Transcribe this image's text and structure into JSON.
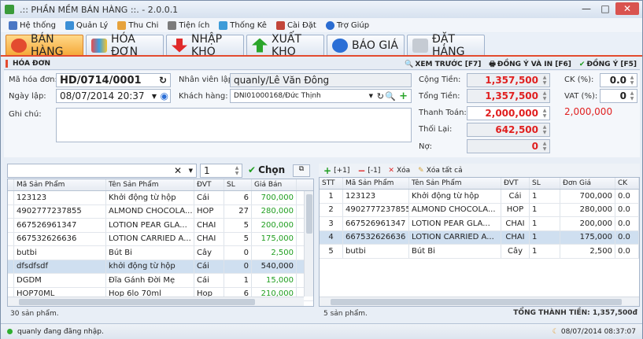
{
  "app": {
    "title": ".:: PHẦN MỀM BÁN HÀNG ::. - 2.0.0.1"
  },
  "menu": [
    {
      "label": "Hệ thống",
      "icon": "system-icon"
    },
    {
      "label": "Quản Lý",
      "icon": "manage-icon"
    },
    {
      "label": "Thu Chi",
      "icon": "money-icon"
    },
    {
      "label": "Tiện ích",
      "icon": "tools-icon"
    },
    {
      "label": "Thống Kê",
      "icon": "stats-icon"
    },
    {
      "label": "Cài Đặt",
      "icon": "settings-icon"
    },
    {
      "label": "Trợ Giúp",
      "icon": "help-icon"
    }
  ],
  "tabs": [
    {
      "label": "BÁN HÀNG",
      "color": "#e34b2f"
    },
    {
      "label": "HÓA ĐƠN",
      "color": "#d54fa0"
    },
    {
      "label": "NHẬP KHO",
      "color": "#e02a2a"
    },
    {
      "label": "XUẤT KHO",
      "color": "#2aa52a"
    },
    {
      "label": "BÁO GIÁ",
      "color": "#2b6fd6"
    },
    {
      "label": "ĐẶT HÀNG",
      "color": "#9aa4b0"
    }
  ],
  "invoice": {
    "header": "HÓA ĐƠN",
    "actions": {
      "preview": "XEM TRƯỚC [F7]",
      "approve_print": "ĐỒNG Ý VÀ IN [F6]",
      "approve": "ĐỒNG Ý [F5]"
    }
  },
  "form": {
    "invoice_no_label": "Mã hóa đơn:",
    "invoice_no": "HD/0714/0001",
    "date_label": "Ngày lập:",
    "date": "08/07/2014 20:37",
    "note_label": "Ghi chú:",
    "staff_label": "Nhân viên lập:",
    "staff": "quanly/Lê Văn Đông",
    "customer_label": "Khách hàng:",
    "customer": "DNI01000168/Đức Thịnh",
    "total_label": "Cộng Tiền:",
    "total": "1,357,500",
    "grand_total_label": "Tổng Tiền:",
    "grand_total": "1,357,500",
    "paid_label": "Thanh Toán:",
    "paid": "2,000,000",
    "change_label": "Thối Lại:",
    "change": "642,500",
    "debt_label": "Nợ:",
    "debt": "0",
    "discount_label": "CK (%):",
    "discount": "0.0",
    "vat_label": "VAT (%):",
    "vat": "0",
    "paid_display": "2,000,000"
  },
  "search": {
    "qty": "1",
    "choose": "Chọn"
  },
  "products": {
    "columns": [
      "Mã Sản Phẩm",
      "Tên Sản Phẩm",
      "ĐVT",
      "SL",
      "Giá Bán"
    ],
    "rows": [
      [
        "123123",
        "Khởi động từ hộp",
        "Cái",
        "6",
        "700,000"
      ],
      [
        "4902777237855",
        "ALMOND CHOCOLA...",
        "HOP",
        "27",
        "280,000"
      ],
      [
        "667526961347",
        "LOTION PEAR GLA...",
        "CHAI",
        "5",
        "200,000"
      ],
      [
        "667532626636",
        "LOTION CARRIED A...",
        "CHAI",
        "5",
        "175,000"
      ],
      [
        "butbi",
        "Bút Bi",
        "Cây",
        "0",
        "2,500"
      ],
      [
        "dfsdfsdf",
        "khởi động từ hộp",
        "Cái",
        "0",
        "540,000"
      ],
      [
        "DGDM",
        "Đĩa Gánh Đời Mẹ",
        "Cái",
        "1",
        "15,000"
      ],
      [
        "HOP70ML",
        "Hop 6lo 70ml",
        "Hop",
        "6",
        "210,000"
      ]
    ],
    "footer": "30 sản phẩm."
  },
  "cart": {
    "toolbar": {
      "add": "[+1]",
      "remove": "[-1]",
      "delete": "Xóa",
      "clear": "Xóa tất cả"
    },
    "columns": [
      "STT",
      "Mã Sản Phẩm",
      "Tên Sản Phẩm",
      "ĐVT",
      "SL",
      "Đơn Giá",
      "CK"
    ],
    "rows": [
      [
        "1",
        "123123",
        "Khởi động từ hộp",
        "Cái",
        "1",
        "700,000",
        "0.0"
      ],
      [
        "2",
        "4902777237855",
        "ALMOND CHOCOLA...",
        "HOP",
        "1",
        "280,000",
        "0.0"
      ],
      [
        "3",
        "667526961347",
        "LOTION PEAR GLA...",
        "CHAI",
        "1",
        "200,000",
        "0.0"
      ],
      [
        "4",
        "667532626636",
        "LOTION CARRIED A...",
        "CHAI",
        "1",
        "175,000",
        "0.0"
      ],
      [
        "5",
        "butbi",
        "Bút Bi",
        "Cây",
        "1",
        "2,500",
        "0.0"
      ]
    ],
    "footer": "5 sản phẩm.",
    "total": "TỔNG THÀNH TIỀN: 1,357,500đ"
  },
  "status": {
    "user": "quanly đang đăng nhập.",
    "datetime": "08/07/2014 08:37:07"
  }
}
